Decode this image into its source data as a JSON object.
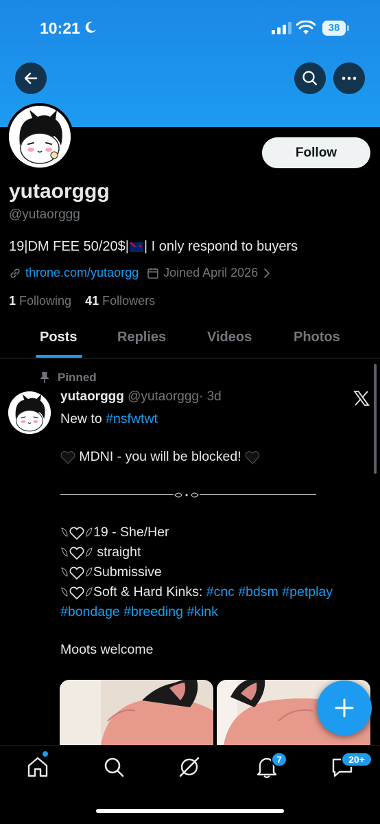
{
  "status_bar": {
    "time": "10:21",
    "battery": "38"
  },
  "header": {
    "back_icon": "arrow-left-icon",
    "search_icon": "search-icon",
    "more_icon": "more-horizontal-icon"
  },
  "profile": {
    "display_name": "yutaorggg",
    "handle": "@yutaorggg",
    "follow_label": "Follow",
    "bio_part1": "19|DM FEE 50/20$|",
    "bio_part2": "| I only respond to buyers",
    "link": "throne.com/yutaorgg",
    "joined": "Joined April 2026",
    "following_count": "1",
    "following_label": "Following",
    "followers_count": "41",
    "followers_label": "Followers"
  },
  "tabs": [
    {
      "label": "Posts",
      "active": true
    },
    {
      "label": "Replies",
      "active": false
    },
    {
      "label": "Videos",
      "active": false
    },
    {
      "label": "Photos",
      "active": false
    }
  ],
  "post": {
    "pinned_label": "Pinned",
    "author_name": "yutaorggg",
    "author_handle": "@yutaorggg",
    "time": "· 3d",
    "line1_prefix": "New to ",
    "line1_tag": "#nsfwtwt",
    "mdni": " MDNI - you will be blocked! ",
    "item1": "19 - She/Her",
    "item2": " straight",
    "item3": "Submissive",
    "item4_prefix": "Soft & Hard Kinks: ",
    "item4_tags": "#cnc #bdsm #petplay",
    "item5_tags": "#bondage #breeding #kink",
    "moots": "Moots welcome"
  },
  "bottom_nav": {
    "notifications_badge": "7",
    "messages_badge": "20+"
  },
  "colors": {
    "accent": "#1d9bf0",
    "background": "#000000",
    "muted": "#71767b"
  }
}
